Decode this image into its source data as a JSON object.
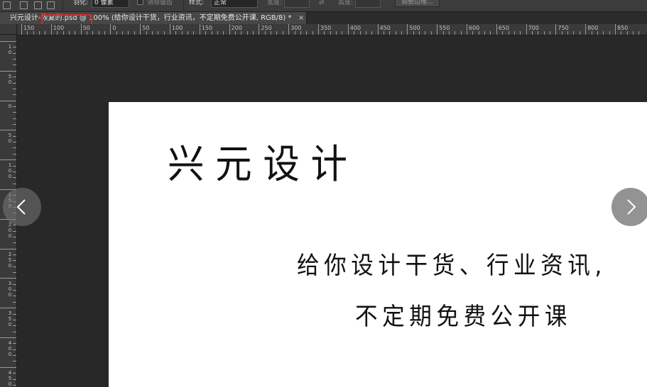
{
  "options_bar": {
    "feather_label": "羽化:",
    "feather_value": "0 像素",
    "antialias_label": "消除锯齿",
    "style_label": "样式:",
    "style_value": "正常",
    "width_label": "宽度:",
    "height_label": "高度:",
    "refine_edge_label": "调整边缘..."
  },
  "document_tab": {
    "title": "兴元设计-恢复的.psd @ 100% (给你设计干货，行业资讯，不定期免费公开课, RGB/8) *",
    "close_glyph": "×"
  },
  "ruler_h": {
    "labels": [
      "150",
      "100",
      "50",
      "0",
      "50",
      "100",
      "150",
      "200",
      "250",
      "300",
      "350",
      "400",
      "450",
      "500",
      "550",
      "600",
      "650",
      "700",
      "750",
      "800",
      "850"
    ]
  },
  "ruler_v": {
    "labels": [
      "1\n0",
      "5\n0",
      "0",
      "5\n0",
      "1\n0\n0",
      "1\n5\n0",
      "2\n0\n0",
      "2\n5\n0",
      "3\n0\n0",
      "3\n5\n0",
      "4\n0\n0",
      "4\n5\n0"
    ]
  },
  "canvas_text": {
    "heading": "兴元设计",
    "line1": "给你设计干货、行业资讯,",
    "line2": "不定期免费公开课"
  },
  "colors": {
    "highlight": "#e0242a",
    "canvas": "#ffffff",
    "workspace": "#282828"
  },
  "icons": {
    "prev": "chevron-left-icon",
    "next": "chevron-right-icon"
  }
}
